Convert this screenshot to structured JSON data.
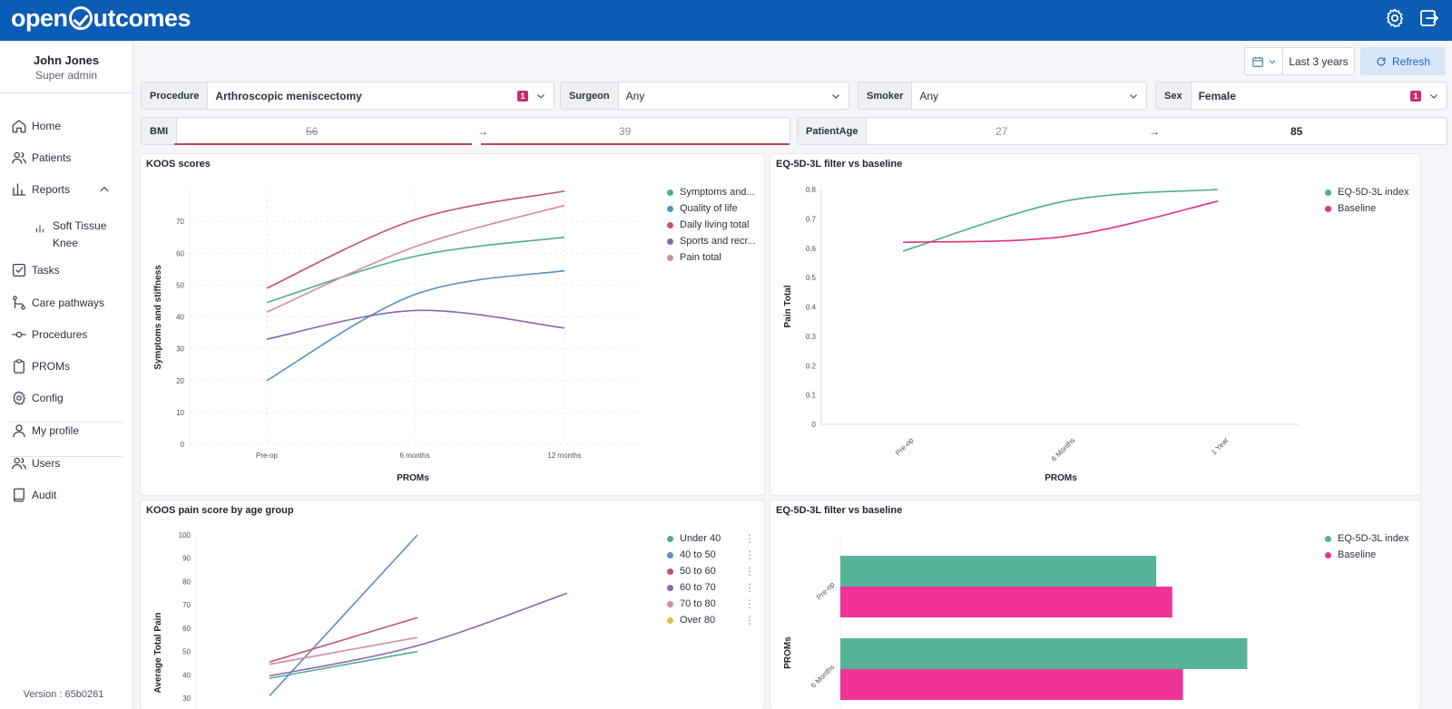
{
  "app": {
    "logo_text": "open",
    "logo_text2": "utcomes"
  },
  "topbar": {
    "settings_icon": "gear-icon",
    "logout_icon": "logout-icon"
  },
  "user": {
    "name": "John Jones",
    "role": "Super admin"
  },
  "sidebar": {
    "items": [
      {
        "label": "Home",
        "icon": "home-icon"
      },
      {
        "label": "Patients",
        "icon": "users-icon"
      },
      {
        "label": "Reports",
        "icon": "bar-chart-icon"
      },
      {
        "label": "Tasks",
        "icon": "checkbox-icon"
      },
      {
        "label": "Care pathways",
        "icon": "route-icon"
      },
      {
        "label": "Procedures",
        "icon": "commit-icon"
      },
      {
        "label": "PROMs",
        "icon": "clipboard-icon"
      },
      {
        "label": "Config",
        "icon": "gear-icon"
      },
      {
        "label": "My profile",
        "icon": "user-icon"
      },
      {
        "label": "Users",
        "icon": "users-icon"
      },
      {
        "label": "Audit",
        "icon": "book-icon"
      }
    ],
    "sub_item": {
      "line1": "Soft Tissue",
      "line2": "Knee",
      "icon": "bar-chart-icon"
    },
    "version": "Version : 65b0261"
  },
  "header": {
    "date_range": "Last 3 years",
    "refresh_label": "Refresh"
  },
  "filters": {
    "procedure": {
      "label": "Procedure",
      "value": "Arthroscopic meniscectomy",
      "badge": "1"
    },
    "surgeon": {
      "label": "Surgeon",
      "value": "Any"
    },
    "smoker": {
      "label": "Smoker",
      "value": "Any"
    },
    "sex": {
      "label": "Sex",
      "value": "Female",
      "badge": "1"
    },
    "bmi": {
      "label": "BMI",
      "min": "56",
      "max": "39",
      "arrow": "→"
    },
    "age": {
      "label": "PatientAge",
      "min": "27",
      "max": "85",
      "arrow": "→"
    }
  },
  "chart_data": [
    {
      "id": "koos",
      "type": "line",
      "title": "KOOS scores",
      "xlabel": "PROMs",
      "ylabel": "Symptoms and stiffness",
      "categories": [
        "Pre-op",
        "6 months",
        "12 months"
      ],
      "ylim": [
        0,
        80
      ],
      "yticks": [
        0,
        10,
        20,
        30,
        40,
        50,
        60,
        70
      ],
      "grid": true,
      "legend_position": "right",
      "series": [
        {
          "name": "Symptoms and...",
          "color": "#4fae8c",
          "values": [
            44.5,
            59,
            65
          ]
        },
        {
          "name": "Quality of life",
          "color": "#5a8fc0",
          "values": [
            20,
            47,
            54.5
          ]
        },
        {
          "name": "Daily living total",
          "color": "#c4507a",
          "values": [
            49,
            70.5,
            79.5
          ]
        },
        {
          "name": "Sports and recr...",
          "color": "#8a66ad",
          "values": [
            33,
            42,
            36.5
          ]
        },
        {
          "name": "Pain total",
          "color": "#d48aa5",
          "values": [
            41.5,
            62,
            75
          ]
        }
      ]
    },
    {
      "id": "eq5d_line",
      "type": "line",
      "title": "EQ-5D-3L filter vs baseline",
      "xlabel": "PROMs",
      "ylabel": "Pain Total",
      "categories": [
        "Pre-op",
        "6 Months",
        "1 Year"
      ],
      "ylim": [
        0,
        0.8
      ],
      "yticks": [
        0,
        0.1,
        0.2,
        0.3,
        0.4,
        0.5,
        0.6,
        0.7,
        0.8
      ],
      "grid": false,
      "legend_position": "right",
      "series": [
        {
          "name": "EQ-5D-3L index",
          "color": "#4fae8c",
          "values": [
            0.59,
            0.76,
            0.8
          ]
        },
        {
          "name": "Baseline",
          "color": "#e0327e",
          "values": [
            0.62,
            0.64,
            0.76
          ]
        }
      ]
    },
    {
      "id": "koos_age",
      "type": "line",
      "title": "KOOS pain score by age group",
      "xlabel": "",
      "ylabel": "Average Total Pain",
      "ylim": [
        30,
        100
      ],
      "yticks": [
        30,
        40,
        50,
        60,
        70,
        80,
        90,
        100
      ],
      "legend_position": "right",
      "series": [
        {
          "name": "Under 40",
          "color": "#4fae8c",
          "x": [
            0,
            1
          ],
          "values": [
            38.5,
            50
          ]
        },
        {
          "name": "40 to 50",
          "color": "#5a8fc0",
          "x": [
            0,
            1
          ],
          "values": [
            31,
            100
          ]
        },
        {
          "name": "50 to 60",
          "color": "#c4507a",
          "x": [
            0,
            1
          ],
          "values": [
            45.5,
            64.5
          ]
        },
        {
          "name": "60 to 70",
          "color": "#8a66ad",
          "x": [
            0,
            1,
            2
          ],
          "values": [
            39.5,
            52.5,
            75
          ]
        },
        {
          "name": "70 to 80",
          "color": "#d48aa5",
          "x": [
            0,
            1
          ],
          "values": [
            44.5,
            56
          ]
        },
        {
          "name": "Over 80",
          "color": "#e0c040",
          "x": [],
          "values": []
        }
      ]
    },
    {
      "id": "eq5d_bar",
      "type": "bar",
      "orientation": "horizontal",
      "title": "EQ-5D-3L filter vs baseline",
      "ylabel": "PROMs",
      "categories": [
        "Pre-op",
        "6 Months"
      ],
      "legend_position": "right",
      "series": [
        {
          "name": "EQ-5D-3L index",
          "color": "#56b39a",
          "values": [
            0.59,
            0.76
          ]
        },
        {
          "name": "Baseline",
          "color": "#f03399",
          "values": [
            0.62,
            0.64
          ]
        }
      ]
    }
  ]
}
